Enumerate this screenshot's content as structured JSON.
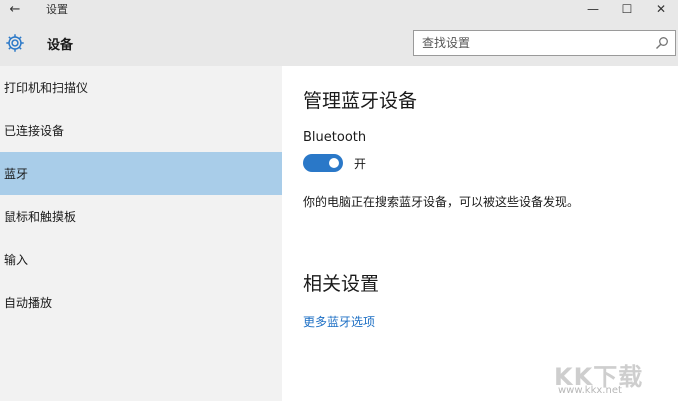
{
  "window": {
    "back_glyph": "←",
    "title": "设置",
    "controls": {
      "minimize": "—",
      "maximize": "☐",
      "close": "✕"
    }
  },
  "header": {
    "title": "设备",
    "search_placeholder": "查找设置"
  },
  "sidebar": {
    "items": [
      {
        "label": "打印机和扫描仪",
        "selected": false
      },
      {
        "label": "已连接设备",
        "selected": false
      },
      {
        "label": "蓝牙",
        "selected": true
      },
      {
        "label": "鼠标和触摸板",
        "selected": false
      },
      {
        "label": "输入",
        "selected": false
      },
      {
        "label": "自动播放",
        "selected": false
      }
    ]
  },
  "main": {
    "section1_title": "管理蓝牙设备",
    "bluetooth_label": "Bluetooth",
    "toggle": {
      "on": true,
      "state_label": "开"
    },
    "description": "你的电脑正在搜索蓝牙设备，可以被这些设备发现。",
    "section2_title": "相关设置",
    "link": "更多蓝牙选项"
  },
  "watermark": {
    "logo": "KK下载",
    "url": "www.kkx.net"
  },
  "colors": {
    "accent": "#2a78c8",
    "selected_bg": "#a9cde9",
    "link": "#1d6fc4",
    "sidebar_bg": "#f2f2f2",
    "header_bg": "#e8e8e8"
  }
}
